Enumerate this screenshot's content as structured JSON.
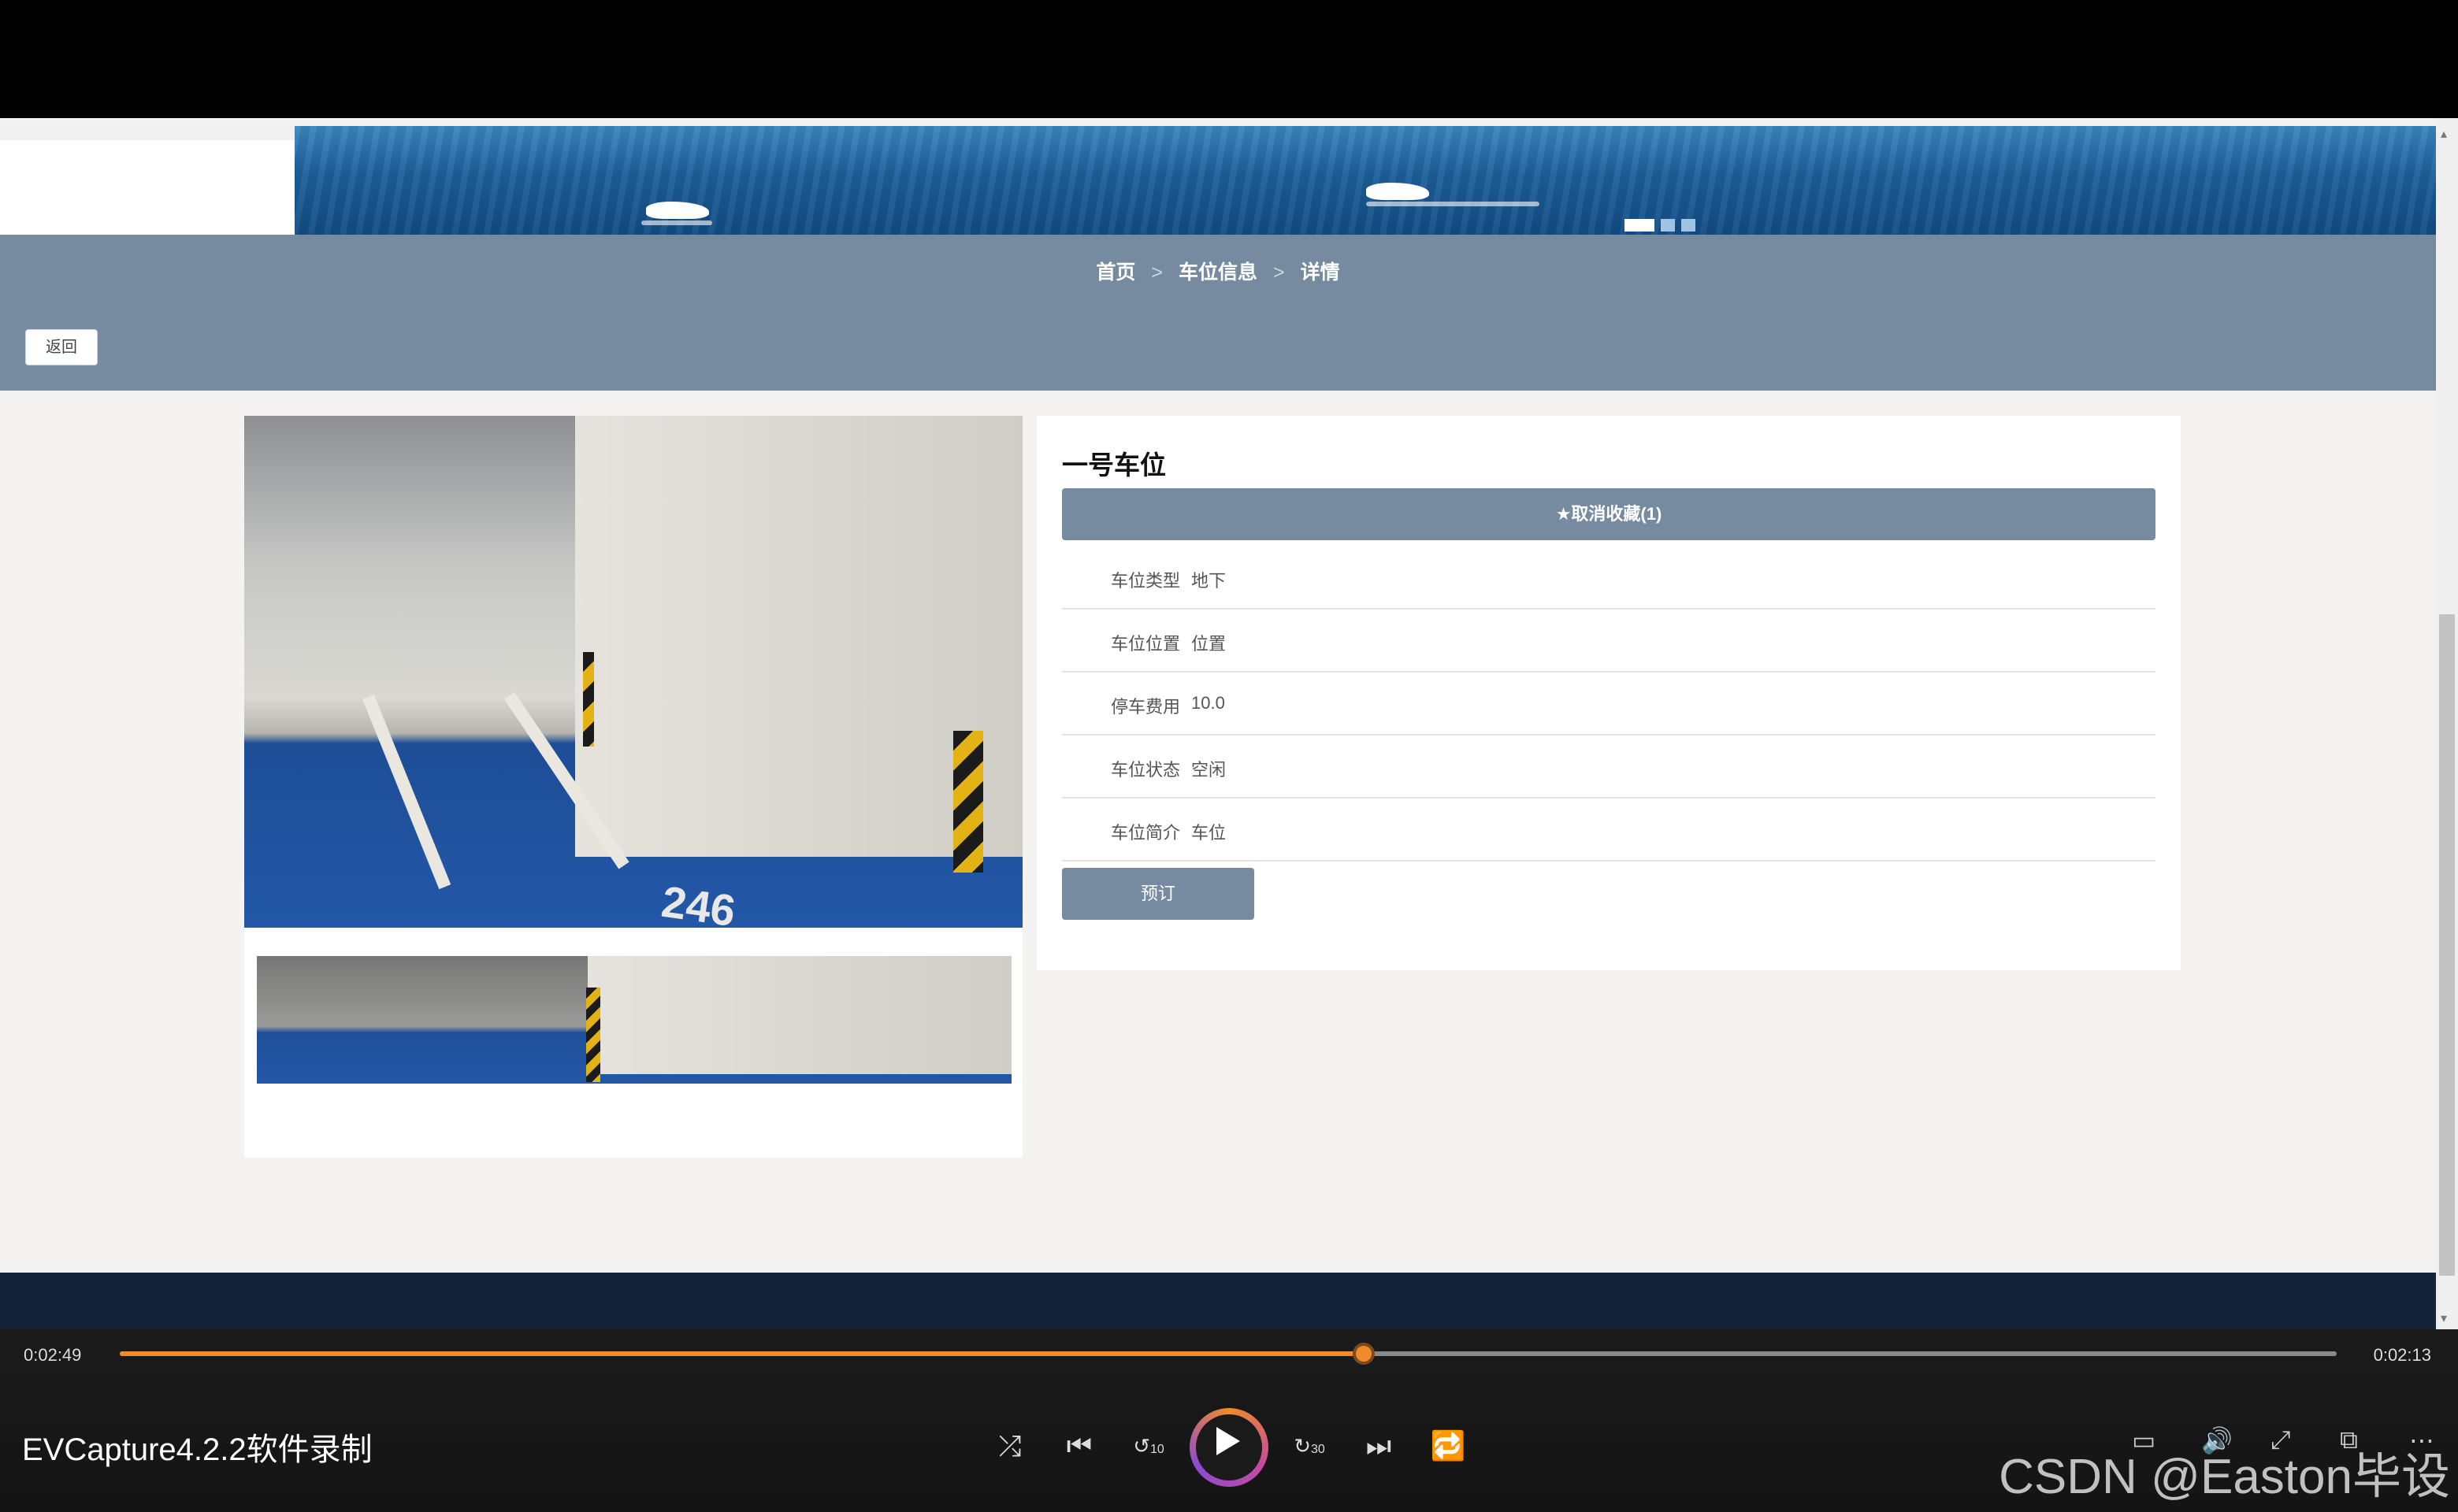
{
  "breadcrumb": {
    "home": "首页",
    "section": "车位信息",
    "current": "详情",
    "separator": ">"
  },
  "toolbar": {
    "back_label": "返回"
  },
  "detail": {
    "title": "一号车位",
    "favorite_label": "★取消收藏(1)",
    "rows": [
      {
        "label": "车位类型",
        "value": "地下"
      },
      {
        "label": "车位位置",
        "value": "位置"
      },
      {
        "label": "停车费用",
        "value": "10.0"
      },
      {
        "label": "车位状态",
        "value": "空闲"
      },
      {
        "label": "车位简介",
        "value": "车位"
      }
    ],
    "reserve_label": "预订"
  },
  "gallery": {
    "photo_number": "246"
  },
  "banner": {
    "slide_count": 3,
    "active_slide": 1
  },
  "player": {
    "elapsed": "0:02:49",
    "total": "0:02:13",
    "progress_fraction": 0.561,
    "recorder": "EVCapture4.2.2软件录制",
    "rewind_seconds": "10",
    "forward_seconds": "30",
    "accent_color": "#f08a2a"
  },
  "watermark": "CSDN @Easton毕设",
  "colors": {
    "band": "#778ba0",
    "footer": "#13233a",
    "page_bg": "#f4f3f2"
  }
}
